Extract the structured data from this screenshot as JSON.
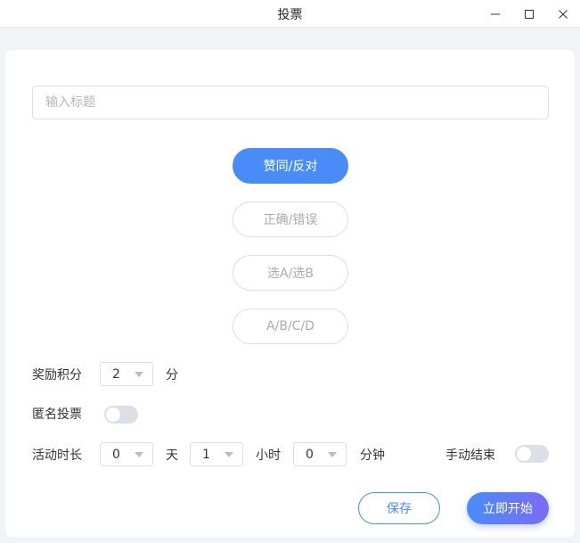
{
  "window": {
    "title": "投票"
  },
  "form": {
    "title_placeholder": "输入标题",
    "title_value": ""
  },
  "vote_types": [
    {
      "label": "赞同/反对",
      "selected": true
    },
    {
      "label": "正确/错误",
      "selected": false
    },
    {
      "label": "选A/选B",
      "selected": false
    },
    {
      "label": "A/B/C/D",
      "selected": false
    }
  ],
  "reward": {
    "label": "奖励积分",
    "value": "2",
    "unit": "分"
  },
  "anonymous": {
    "label": "匿名投票",
    "on": false
  },
  "duration": {
    "label": "活动时长",
    "days": "0",
    "days_unit": "天",
    "hours": "1",
    "hours_unit": "小时",
    "minutes": "0",
    "minutes_unit": "分钟"
  },
  "manual_end": {
    "label": "手动结束",
    "on": false
  },
  "actions": {
    "save_label": "保存",
    "start_label": "立即开始"
  },
  "colors": {
    "accent": "#4a8cf7",
    "accent_gradient_end": "#7b6cf6",
    "toggle_off": "#dcdfe6"
  }
}
